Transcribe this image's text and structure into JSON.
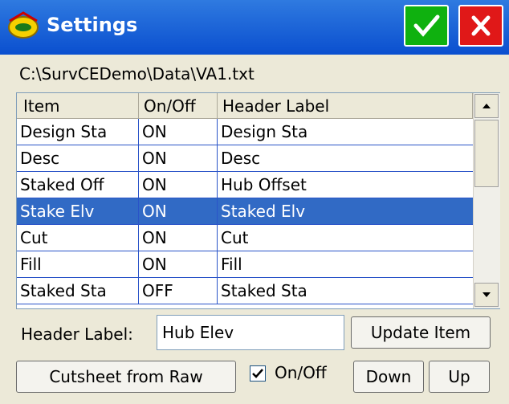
{
  "window": {
    "title": "Settings"
  },
  "file_path": "C:\\SurvCEDemo\\Data\\VA1.txt",
  "table": {
    "columns": [
      "Item",
      "On/Off",
      "Header Label"
    ],
    "rows": [
      {
        "item": "Design Sta",
        "onoff": "ON",
        "header": "Design Sta",
        "selected": false
      },
      {
        "item": "Desc",
        "onoff": "ON",
        "header": "Desc",
        "selected": false
      },
      {
        "item": "Staked Off",
        "onoff": "ON",
        "header": "Hub Offset",
        "selected": false
      },
      {
        "item": "Stake Elv",
        "onoff": "ON",
        "header": "Staked Elv",
        "selected": true
      },
      {
        "item": "Cut",
        "onoff": "ON",
        "header": "Cut",
        "selected": false
      },
      {
        "item": "Fill",
        "onoff": "ON",
        "header": "Fill",
        "selected": false
      },
      {
        "item": "Staked Sta",
        "onoff": "OFF",
        "header": "Staked Sta",
        "selected": false
      }
    ]
  },
  "form": {
    "header_label": "Header Label:",
    "header_value": "Hub Elev",
    "update_button": "Update Item",
    "cutsheet_button": "Cutsheet from Raw",
    "onoff_checkbox_label": "On/Off",
    "onoff_checked": true,
    "down_button": "Down",
    "up_button": "Up"
  },
  "colors": {
    "titlebar": "#0a4fcf",
    "selection": "#316ac5",
    "ok": "#0fb10f",
    "close": "#e01818"
  },
  "icons": [
    "app-logo-icon",
    "checkmark-icon",
    "close-x-icon",
    "scroll-up-arrow-icon",
    "scroll-down-arrow-icon",
    "checkbox-check-icon"
  ]
}
